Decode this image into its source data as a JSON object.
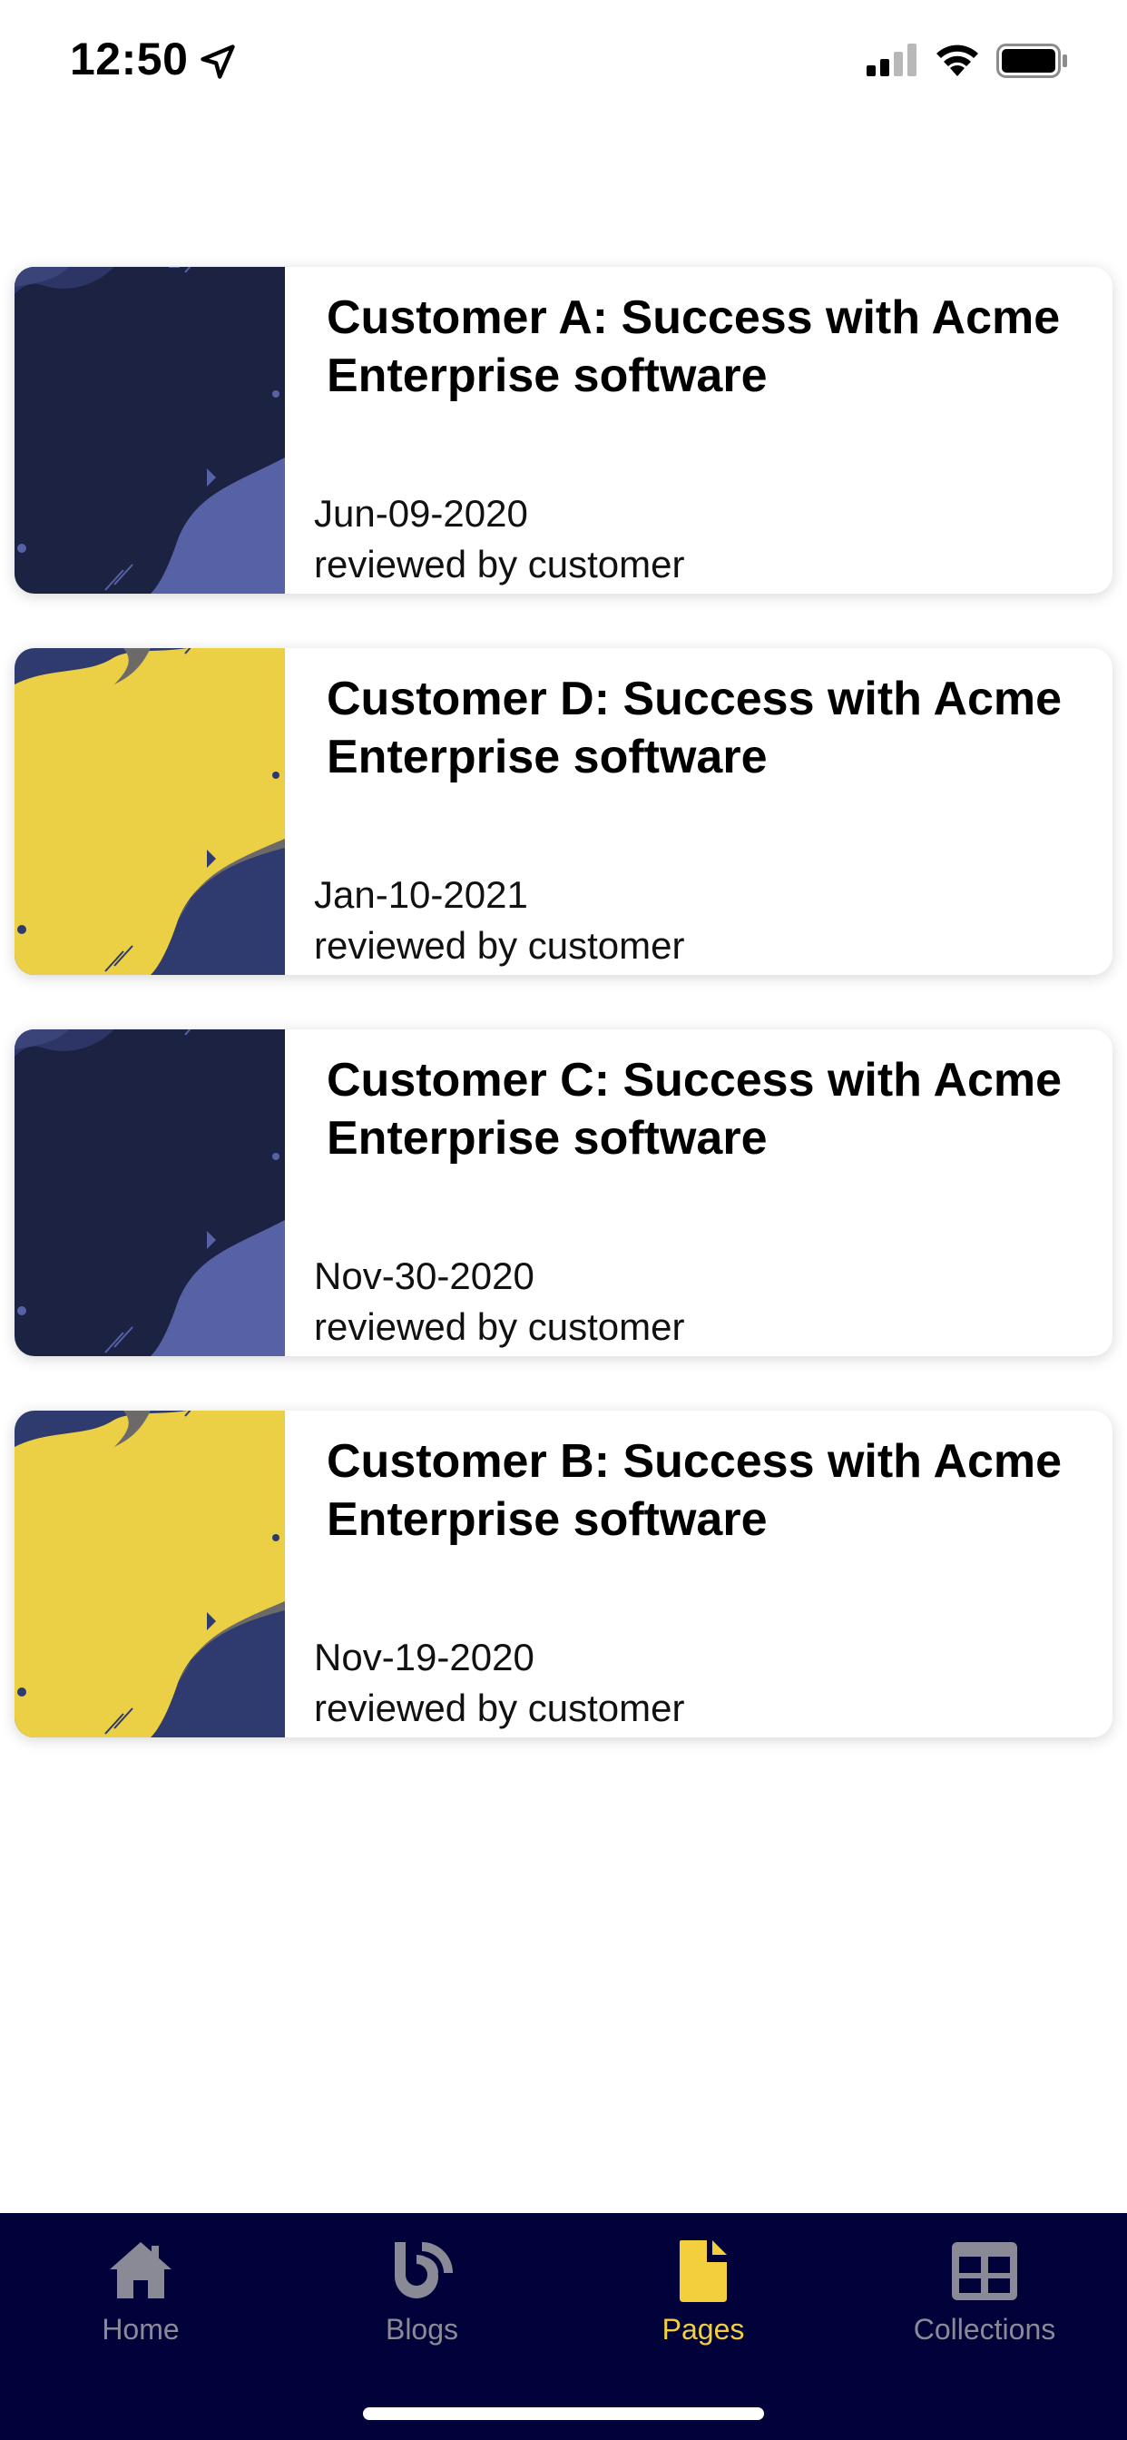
{
  "status_bar": {
    "time": "12:50"
  },
  "colors": {
    "dark_navy": "#1b2242",
    "periwinkle": "#5761a6",
    "yellow": "#ebcf45",
    "tab_bar": "#02023a",
    "active_tab": "#f3cf3e",
    "inactive_tab": "#8a8a96"
  },
  "cards": [
    {
      "title": "Customer A: Success with Acme Enterprise software",
      "date": "Jun-09-2020",
      "reviewed": "reviewed by customer",
      "theme": "dark"
    },
    {
      "title": "Customer D: Success with Acme Enterprise software",
      "date": "Jan-10-2021",
      "reviewed": "reviewed by customer",
      "theme": "yellow"
    },
    {
      "title": "Customer C: Success with Acme Enterprise software",
      "date": "Nov-30-2020",
      "reviewed": "reviewed by customer",
      "theme": "dark"
    },
    {
      "title": "Customer B: Success with Acme Enterprise software",
      "date": "Nov-19-2020",
      "reviewed": "reviewed by customer",
      "theme": "yellow"
    }
  ],
  "tab_bar": {
    "tabs": [
      {
        "label": "Home",
        "icon": "home-icon",
        "active": false
      },
      {
        "label": "Blogs",
        "icon": "blog-icon",
        "active": false
      },
      {
        "label": "Pages",
        "icon": "page-icon",
        "active": true
      },
      {
        "label": "Collections",
        "icon": "collections-icon",
        "active": false
      }
    ]
  }
}
